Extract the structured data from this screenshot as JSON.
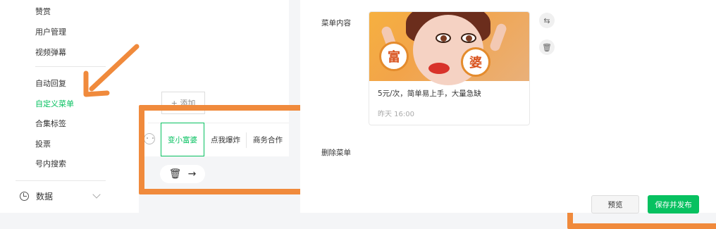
{
  "sidebar": {
    "items": [
      {
        "label": "赞赏"
      },
      {
        "label": "用户管理"
      },
      {
        "label": "视频弹幕"
      },
      {
        "label": "自动回复"
      },
      {
        "label": "自定义菜单"
      },
      {
        "label": "合集标签"
      },
      {
        "label": "投票"
      },
      {
        "label": "号内搜索"
      }
    ],
    "section_label": "数据"
  },
  "phone": {
    "add_label": "+ 添加",
    "menu_buttons": [
      {
        "label": "变小富婆"
      },
      {
        "label": "点我爆炸"
      },
      {
        "label": "商务合作"
      }
    ],
    "delete_icon": "🗑",
    "forward_icon": "→"
  },
  "editor": {
    "menu_content_label": "菜单内容",
    "card": {
      "coin_left": "富",
      "coin_right": "婆",
      "title": "5元/次，简单易上手，大量急缺",
      "time": "昨天 16:00"
    },
    "delete_menu_label": "删除菜单"
  },
  "actions": {
    "preview_label": "预览",
    "save_publish_label": "保存并发布"
  },
  "colors": {
    "accent": "#07c160",
    "annotation": "#f08a3c"
  }
}
